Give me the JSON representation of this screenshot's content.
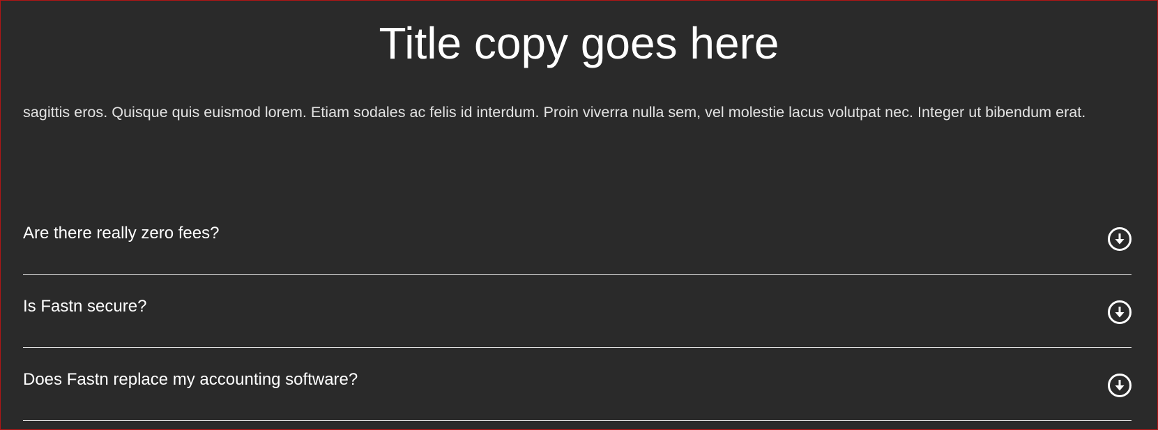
{
  "page": {
    "title": "Title copy goes here",
    "intro": "sagittis eros. Quisque quis euismod lorem. Etiam sodales ac felis id interdum. Proin viverra nulla sem, vel molestie lacus volutpat nec. Integer ut bibendum erat."
  },
  "faq": {
    "items": [
      {
        "question": "Are there really zero fees?",
        "icon": "arrow-down-circle-icon"
      },
      {
        "question": "Is Fastn secure?",
        "icon": "arrow-down-circle-icon"
      },
      {
        "question": "Does Fastn replace my accounting software?",
        "icon": "arrow-down-circle-icon"
      }
    ]
  },
  "colors": {
    "background": "#2a2a2a",
    "frame_border": "#b01616",
    "text": "#ffffff",
    "divider": "#e6e6e6"
  }
}
